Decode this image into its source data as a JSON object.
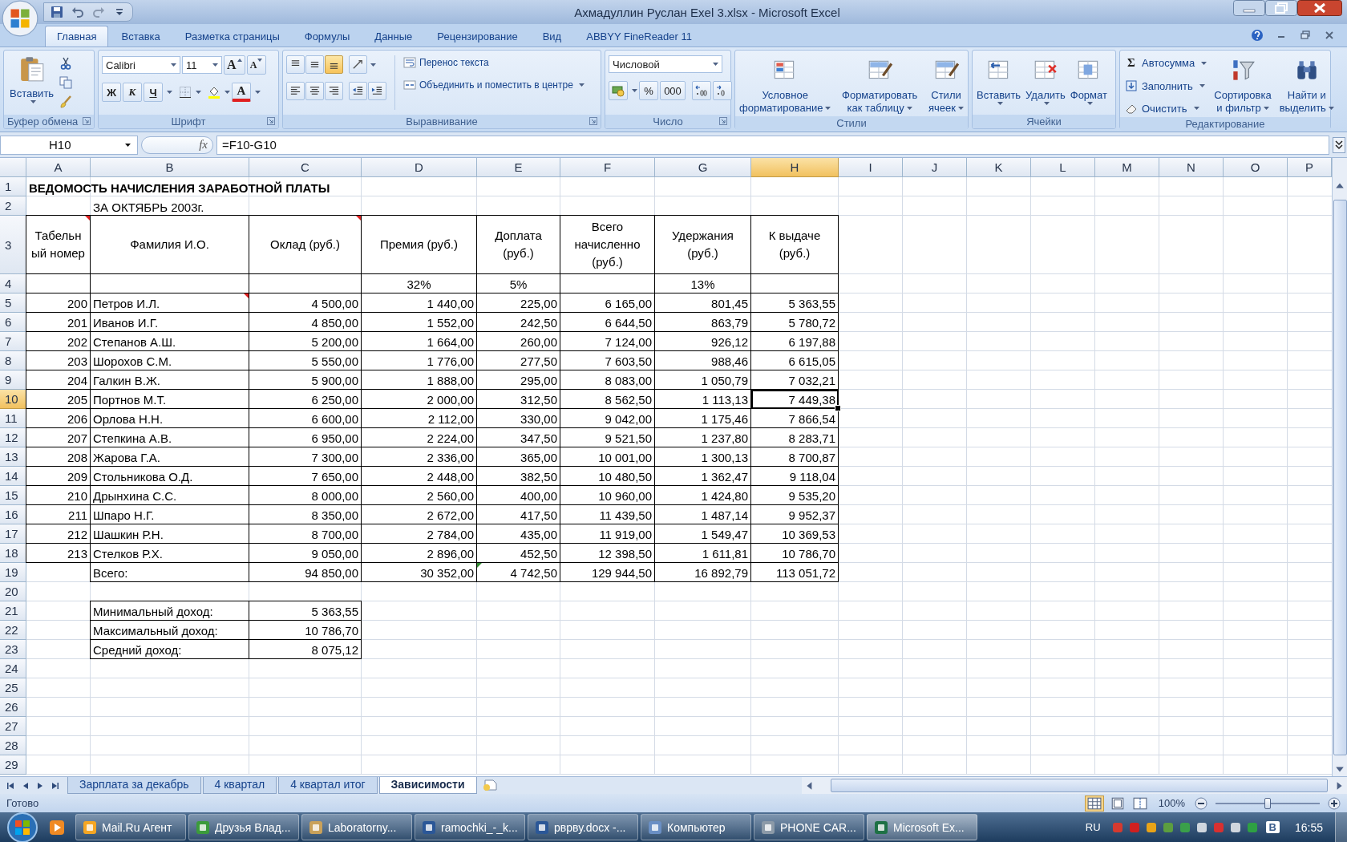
{
  "window": {
    "title": "Ахмадуллин Руслан Exel 3.xlsx - Microsoft Excel"
  },
  "ribbon_tabs": [
    {
      "label": "Главная",
      "selected": true
    },
    {
      "label": "Вставка",
      "selected": false
    },
    {
      "label": "Разметка страницы",
      "selected": false
    },
    {
      "label": "Формулы",
      "selected": false
    },
    {
      "label": "Данные",
      "selected": false
    },
    {
      "label": "Рецензирование",
      "selected": false
    },
    {
      "label": "Вид",
      "selected": false
    },
    {
      "label": "ABBYY FineReader 11",
      "selected": false
    }
  ],
  "ribbon_groups": [
    {
      "kind": "clipboard",
      "label": "Буфер обмена",
      "paste": "Вставить"
    },
    {
      "kind": "font",
      "label": "Шрифт",
      "font_name": "Calibri",
      "font_size": "11",
      "grow": "A",
      "shrink": "A",
      "bold": "Ж",
      "italic": "К",
      "underline": "Ч",
      "font_color": "A"
    },
    {
      "kind": "alignment",
      "label": "Выравнивание",
      "vertical_align": [
        {
          "selected": false
        },
        {
          "selected": false
        },
        {
          "selected": true
        }
      ],
      "wrap": "Перенос текста",
      "merge": "Объединить и поместить в центре"
    },
    {
      "kind": "number",
      "label": "Число",
      "format": "Числовой",
      "percent": "%",
      "thousands": "000"
    },
    {
      "kind": "styles",
      "label": "Стили",
      "buttons": [
        {
          "lines": [
            "Условное",
            "форматирование"
          ]
        },
        {
          "lines": [
            "Форматировать",
            "как таблицу"
          ]
        },
        {
          "lines": [
            "Стили",
            "ячеек"
          ]
        }
      ]
    },
    {
      "kind": "cells",
      "label": "Ячейки",
      "buttons": [
        {
          "lines": [
            "Вставить"
          ]
        },
        {
          "lines": [
            "Удалить"
          ]
        },
        {
          "lines": [
            "Формат"
          ]
        }
      ]
    },
    {
      "kind": "editing",
      "label": "Редактирование",
      "sum_sign": "Σ",
      "small_buttons": [
        "Автосумма",
        "Заполнить",
        "Очистить"
      ],
      "buttons": [
        {
          "lines": [
            "Сортировка",
            "и фильтр"
          ]
        },
        {
          "lines": [
            "Найти и",
            "выделить"
          ]
        }
      ]
    }
  ],
  "formula_bar": {
    "name_box": "H10",
    "function_label": "fx",
    "formula": "=F10-G10"
  },
  "columns": [
    {
      "label": "A",
      "selected": false
    },
    {
      "label": "B",
      "selected": false
    },
    {
      "label": "C",
      "selected": false
    },
    {
      "label": "D",
      "selected": false
    },
    {
      "label": "E",
      "selected": false
    },
    {
      "label": "F",
      "selected": false
    },
    {
      "label": "G",
      "selected": false
    },
    {
      "label": "H",
      "selected": true
    },
    {
      "label": "I",
      "selected": false
    },
    {
      "label": "J",
      "selected": false
    },
    {
      "label": "K",
      "selected": false
    },
    {
      "label": "L",
      "selected": false
    },
    {
      "label": "M",
      "selected": false
    },
    {
      "label": "N",
      "selected": false
    },
    {
      "label": "O",
      "selected": false
    },
    {
      "label": "P",
      "selected": false
    }
  ],
  "rows": [
    {
      "number": "1",
      "kind": "title",
      "selected": false,
      "cells": [
        "ВЕДОМОСТЬ НАЧИСЛЕНИЯ ЗАРАБОТНОЙ ПЛАТЫ"
      ]
    },
    {
      "number": "2",
      "kind": "subtitle",
      "selected": false,
      "cells": [
        null,
        "ЗА ОКТЯБРЬ 2003г."
      ]
    },
    {
      "number": "3",
      "kind": "header",
      "selected": false,
      "cells": [
        {
          "text": "Табельный номер",
          "comment": true
        },
        "Фамилия И.О.",
        {
          "text": "Оклад (руб.)",
          "comment": true
        },
        "Премия (руб.)",
        "Доплата (руб.)",
        "Всего начисленно (руб.)",
        "Удержания (руб.)",
        "К выдаче (руб.)"
      ]
    },
    {
      "number": "4",
      "kind": "percent",
      "selected": false,
      "cells": [
        null,
        null,
        null,
        "32%",
        "5%",
        null,
        "13%",
        null
      ]
    },
    {
      "number": "5",
      "kind": "data",
      "selected": false,
      "cells": [
        "200",
        {
          "text": "Петров И.Л.",
          "comment": true
        },
        "4 500,00",
        "1 440,00",
        "225,00",
        "6 165,00",
        "801,45",
        "5 363,55"
      ]
    },
    {
      "number": "6",
      "kind": "data",
      "selected": false,
      "cells": [
        "201",
        "Иванов И.Г.",
        "4 850,00",
        "1 552,00",
        "242,50",
        "6 644,50",
        "863,79",
        "5 780,72"
      ]
    },
    {
      "number": "7",
      "kind": "data",
      "selected": false,
      "cells": [
        "202",
        "Степанов А.Ш.",
        "5 200,00",
        "1 664,00",
        "260,00",
        "7 124,00",
        "926,12",
        "6 197,88"
      ]
    },
    {
      "number": "8",
      "kind": "data",
      "selected": false,
      "cells": [
        "203",
        "Шорохов С.М.",
        "5 550,00",
        "1 776,00",
        "277,50",
        "7 603,50",
        "988,46",
        "6 615,05"
      ]
    },
    {
      "number": "9",
      "kind": "data",
      "selected": false,
      "cells": [
        "204",
        "Галкин В.Ж.",
        "5 900,00",
        "1 888,00",
        "295,00",
        "8 083,00",
        "1 050,79",
        "7 032,21"
      ]
    },
    {
      "number": "10",
      "kind": "data",
      "selected": true,
      "cells": [
        "205",
        "Портнов М.Т.",
        "6 250,00",
        "2 000,00",
        "312,50",
        "8 562,50",
        "1 113,13",
        "7 449,38"
      ]
    },
    {
      "number": "11",
      "kind": "data",
      "selected": false,
      "cells": [
        "206",
        "Орлова Н.Н.",
        "6 600,00",
        "2 112,00",
        "330,00",
        "9 042,00",
        "1 175,46",
        "7 866,54"
      ]
    },
    {
      "number": "12",
      "kind": "data",
      "selected": false,
      "cells": [
        "207",
        "Степкина А.В.",
        "6 950,00",
        "2 224,00",
        "347,50",
        "9 521,50",
        "1 237,80",
        "8 283,71"
      ]
    },
    {
      "number": "13",
      "kind": "data",
      "selected": false,
      "cells": [
        "208",
        "Жарова Г.А.",
        "7 300,00",
        "2 336,00",
        "365,00",
        "10 001,00",
        "1 300,13",
        "8 700,87"
      ]
    },
    {
      "number": "14",
      "kind": "data",
      "selected": false,
      "cells": [
        "209",
        "Стольникова О.Д.",
        "7 650,00",
        "2 448,00",
        "382,50",
        "10 480,50",
        "1 362,47",
        "9 118,04"
      ]
    },
    {
      "number": "15",
      "kind": "data",
      "selected": false,
      "cells": [
        "210",
        "Дрынхина С.С.",
        "8 000,00",
        "2 560,00",
        "400,00",
        "10 960,00",
        "1 424,80",
        "9 535,20"
      ]
    },
    {
      "number": "16",
      "kind": "data",
      "selected": false,
      "cells": [
        "211",
        "Шпаро Н.Г.",
        "8 350,00",
        "2 672,00",
        "417,50",
        "11 439,50",
        "1 487,14",
        "9 952,37"
      ]
    },
    {
      "number": "17",
      "kind": "data",
      "selected": false,
      "cells": [
        "212",
        "Шашкин Р.Н.",
        "8 700,00",
        "2 784,00",
        "435,00",
        "11 919,00",
        "1 549,47",
        "10 369,53"
      ]
    },
    {
      "number": "18",
      "kind": "data",
      "selected": false,
      "cells": [
        "213",
        "Стелков Р.Х.",
        "9 050,00",
        "2 896,00",
        "452,50",
        "12 398,50",
        "1 611,81",
        "10 786,70"
      ]
    },
    {
      "number": "19",
      "kind": "total",
      "selected": false,
      "cells": [
        null,
        "Всего:",
        "94 850,00",
        "30 352,00",
        {
          "text": "4 742,50",
          "error": true
        },
        "129 944,50",
        "16 892,79",
        "113 051,72"
      ]
    },
    {
      "number": "20",
      "kind": "blank",
      "selected": false
    },
    {
      "number": "21",
      "kind": "summary",
      "selected": false,
      "cells": [
        null,
        "Минимальный доход:",
        "5 363,55"
      ]
    },
    {
      "number": "22",
      "kind": "summary",
      "selected": false,
      "cells": [
        null,
        "Максимальный доход:",
        "10 786,70"
      ]
    },
    {
      "number": "23",
      "kind": "summary",
      "selected": false,
      "cells": [
        null,
        "Средний доход:",
        "8 075,12"
      ]
    },
    {
      "number": "24",
      "kind": "blank",
      "selected": false
    },
    {
      "number": "25",
      "kind": "blank",
      "selected": false
    },
    {
      "number": "26",
      "kind": "blank",
      "selected": false
    },
    {
      "number": "27",
      "kind": "blank",
      "selected": false
    },
    {
      "number": "28",
      "kind": "blank",
      "selected": false
    },
    {
      "number": "29",
      "kind": "blank",
      "selected": false
    }
  ],
  "sheet_tabs": [
    {
      "label": "Зарплата за декабрь",
      "selected": false
    },
    {
      "label": "4 квартал",
      "selected": false
    },
    {
      "label": "4 квартал итог",
      "selected": false
    },
    {
      "label": "Зависимости",
      "selected": true
    }
  ],
  "status_bar": {
    "text": "Готово",
    "zoom": {
      "reading": "100%",
      "level": 0.5
    }
  },
  "taskbar": {
    "items": [
      {
        "label": "Mail.Ru Агент",
        "selected": false
      },
      {
        "label": "Друзья Влад...",
        "selected": false
      },
      {
        "label": "Laboratorny...",
        "selected": false
      },
      {
        "label": "ramochki_-_k...",
        "selected": false
      },
      {
        "label": "рврву.docx -...",
        "selected": false
      },
      {
        "label": "Компьютер",
        "selected": false
      },
      {
        "label": "PHONE CAR...",
        "selected": false
      },
      {
        "label": "Microsoft Ex...",
        "selected": true
      }
    ],
    "language": "RU",
    "tray_badge": "B",
    "clock": "16:55"
  }
}
